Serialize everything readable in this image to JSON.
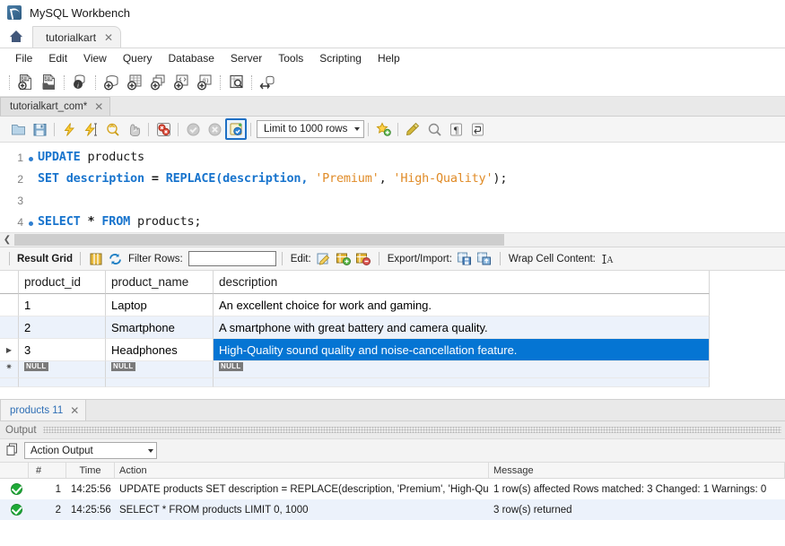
{
  "window": {
    "title": "MySQL Workbench",
    "logo_icon": "mysql-workbench-logo"
  },
  "connection_tabs": {
    "home_icon": "home-icon",
    "tabs": [
      {
        "label": "tutorialkart",
        "close_icon": "close-icon"
      }
    ]
  },
  "menubar": {
    "items": [
      "File",
      "Edit",
      "View",
      "Query",
      "Database",
      "Server",
      "Tools",
      "Scripting",
      "Help"
    ]
  },
  "main_toolbar": {
    "icons": [
      "new-sql-tab-icon",
      "open-sql-script-icon",
      "connection-info-icon",
      "create-schema-icon",
      "create-table-icon",
      "create-view-icon",
      "create-procedure-icon",
      "create-function-icon",
      "search-data-icon",
      "reconnect-server-icon"
    ]
  },
  "editor_tabs": {
    "tabs": [
      {
        "label": "tutorialkart_com*",
        "close_icon": "close-icon"
      }
    ]
  },
  "sql_toolbar": {
    "icons": [
      "open-file-icon",
      "save-file-icon",
      "execute-statement-icon",
      "execute-current-statement-icon",
      "explain-query-icon",
      "stop-query-icon",
      "toggle-stop-on-error-icon",
      "commit-icon",
      "rollback-icon",
      "toggle-autocommit-icon",
      "beautify-sql-icon",
      "find-icon",
      "toggle-invisible-chars-icon",
      "toggle-word-wrap-icon"
    ],
    "limit_dropdown": {
      "value": "Limit to 1000 rows",
      "caret_icon": "chevron-down-icon"
    }
  },
  "editor": {
    "lines": [
      {
        "number": "1",
        "has_marker": true,
        "tokens": [
          {
            "t": "UPDATE",
            "c": "kw"
          },
          {
            "t": " products",
            "c": "pl"
          }
        ]
      },
      {
        "number": "2",
        "has_marker": false,
        "tokens": [
          {
            "t": "SET description ",
            "c": "kw"
          },
          {
            "t": "= ",
            "c": "op"
          },
          {
            "t": "REPLACE",
            "c": "fn"
          },
          {
            "t": "(description, ",
            "c": "kw"
          },
          {
            "t": "'Premium'",
            "c": "str"
          },
          {
            "t": ", ",
            "c": "pl"
          },
          {
            "t": "'High-Quality'",
            "c": "str"
          },
          {
            "t": ");",
            "c": "pl"
          }
        ]
      },
      {
        "number": "3",
        "has_marker": false,
        "tokens": []
      },
      {
        "number": "4",
        "has_marker": true,
        "tokens": [
          {
            "t": "SELECT ",
            "c": "kw"
          },
          {
            "t": "* ",
            "c": "op"
          },
          {
            "t": "FROM",
            "c": "kw"
          },
          {
            "t": " products;",
            "c": "pl"
          }
        ]
      }
    ],
    "scroll_left_icon": "chevron-left-icon"
  },
  "result_toolbar": {
    "result_grid_label": "Result Grid",
    "grid_view_icon": "grid-view-icon",
    "refresh_icon": "refresh-icon",
    "filter_label": "Filter Rows:",
    "filter_value": "",
    "filter_placeholder": "",
    "edit_label": "Edit:",
    "edit_icons": [
      "edit-cell-icon",
      "insert-row-icon",
      "delete-row-icon"
    ],
    "export_label": "Export/Import:",
    "export_icons": [
      "export-recordset-icon",
      "import-recordset-icon"
    ],
    "wrap_label": "Wrap Cell Content:",
    "wrap_icon": "wrap-cell-icon"
  },
  "result_grid": {
    "columns": [
      "product_id",
      "product_name",
      "description"
    ],
    "rows": [
      {
        "marker": "",
        "product_id": "1",
        "product_name": "Laptop",
        "description": "An excellent choice for work and gaming.",
        "selected": false,
        "alt": false
      },
      {
        "marker": "",
        "product_id": "2",
        "product_name": "Smartphone",
        "description": "A smartphone with great battery and camera quality.",
        "selected": false,
        "alt": true
      },
      {
        "marker": "current-row-arrow-icon",
        "product_id": "3",
        "product_name": "Headphones",
        "description": "High-Quality sound quality and noise-cancellation feature.",
        "selected": true,
        "alt": false
      }
    ],
    "placeholder_row": {
      "marker": "new-row-icon",
      "null_label": "NULL"
    }
  },
  "resultset_tabs": {
    "tabs": [
      {
        "label": "products 11",
        "close_icon": "close-icon"
      }
    ]
  },
  "output_panel": {
    "title": "Output",
    "copy_icon": "copy-icon",
    "dropdown_value": "Action Output",
    "dropdown_caret_icon": "chevron-down-icon",
    "columns": [
      "#",
      "Time",
      "Action",
      "Message"
    ],
    "rows": [
      {
        "status_icon": "success-icon",
        "num": "1",
        "time": "14:25:56",
        "action": "UPDATE products SET description = REPLACE(description, 'Premium', 'High-Quality')",
        "message": "1 row(s) affected Rows matched: 3  Changed: 1  Warnings: 0",
        "alt": false
      },
      {
        "status_icon": "success-icon",
        "num": "2",
        "time": "14:25:56",
        "action": "SELECT * FROM products LIMIT 0, 1000",
        "message": "3 row(s) returned",
        "alt": true
      }
    ]
  },
  "colors": {
    "selection_blue": "#0575d3",
    "alt_row": "#ecf2fb",
    "keyword_blue": "#1874cd",
    "string_orange": "#e08b27",
    "success_green": "#1faa38"
  }
}
